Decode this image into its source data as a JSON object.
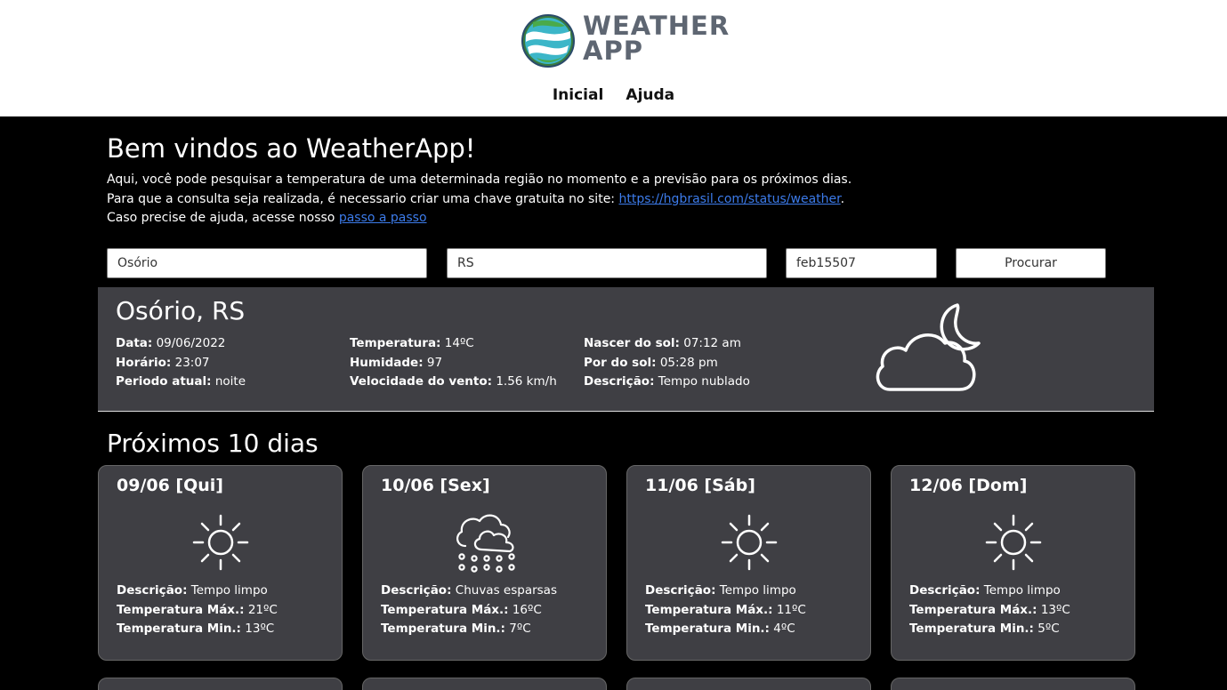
{
  "header": {
    "logo_line1": "WEATHER",
    "logo_line2": "APP",
    "nav": [
      "Inicial",
      "Ajuda"
    ]
  },
  "welcome": {
    "title": "Bem vindos ao WeatherApp!",
    "line1": "Aqui, você pode pesquisar a temperatura de uma determinada região no momento e a previsão para os próximos dias.",
    "line2_prefix": "Para que a consulta seja realizada, é necessario criar uma chave gratuita no site: ",
    "line2_link": "https://hgbrasil.com/status/weather",
    "line2_suffix": ".",
    "line3_prefix": "Caso precise de ajuda, acesse nosso ",
    "line3_link": "passo a passo"
  },
  "search": {
    "city": "Osório",
    "state": "RS",
    "key": "feb15507",
    "button": "Procurar"
  },
  "current": {
    "location": "Osório, RS",
    "date_label": "Data:",
    "date": "09/06/2022",
    "time_label": "Horário:",
    "time": "23:07",
    "period_label": "Periodo atual:",
    "period": "noite",
    "temp_label": "Temperatura:",
    "temp": "14ºC",
    "humidity_label": "Humidade:",
    "humidity": "97",
    "wind_label": "Velocidade do vento:",
    "wind": "1.56 km/h",
    "sunrise_label": "Nascer do sol:",
    "sunrise": "07:12 am",
    "sunset_label": "Por do sol:",
    "sunset": "05:28 pm",
    "desc_label": "Descrição:",
    "desc": "Tempo nublado",
    "icon": "cloud-moon-icon"
  },
  "forecast": {
    "title": "Próximos 10 dias",
    "desc_label": "Descrição:",
    "max_label": "Temperatura Máx.:",
    "min_label": "Temperatura Min.:",
    "days": [
      {
        "date": "09/06 [Qui]",
        "icon": "sun-icon",
        "desc": "Tempo limpo",
        "max": "21ºC",
        "min": "13ºC"
      },
      {
        "date": "10/06 [Sex]",
        "icon": "cloud-rain-icon",
        "desc": "Chuvas esparsas",
        "max": "16ºC",
        "min": "7ºC"
      },
      {
        "date": "11/06 [Sáb]",
        "icon": "sun-icon",
        "desc": "Tempo limpo",
        "max": "11ºC",
        "min": "4ºC"
      },
      {
        "date": "12/06 [Dom]",
        "icon": "sun-icon",
        "desc": "Tempo limpo",
        "max": "13ºC",
        "min": "5ºC"
      }
    ]
  },
  "colors": {
    "panel": "#3f3f44",
    "link": "#3c7bea",
    "logo_text": "#5e6672"
  }
}
